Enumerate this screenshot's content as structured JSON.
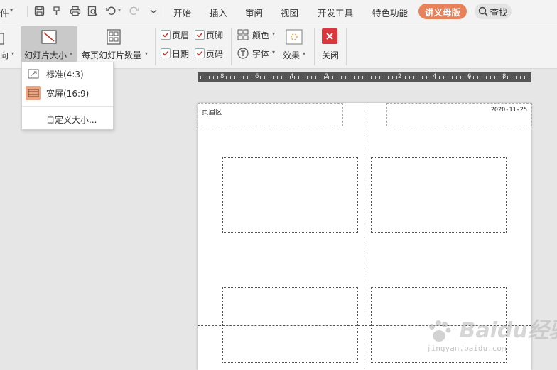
{
  "quick_access": {
    "file_menu_fragment": "件"
  },
  "tabs": [
    {
      "label": "开始"
    },
    {
      "label": "插入"
    },
    {
      "label": "审阅"
    },
    {
      "label": "视图"
    },
    {
      "label": "开发工具"
    },
    {
      "label": "特色功能"
    },
    {
      "label": "讲义母版",
      "active": true
    }
  ],
  "search": {
    "label": "查找"
  },
  "ribbon": {
    "orientation_fragment": "向",
    "slide_size": "幻灯片大小",
    "per_page": "每页幻灯片数量",
    "header_cb": "页眉",
    "footer_cb": "页脚",
    "date_cb": "日期",
    "page_no_cb": "页码",
    "color": "颜色",
    "font": "字体",
    "effects": "效果",
    "close": "关闭"
  },
  "dropdown": {
    "items": [
      {
        "label": "标准(4:3)",
        "icon": "standard-ratio-icon"
      },
      {
        "label": "宽屏(16:9)",
        "icon": "widescreen-ratio-icon",
        "selected": true
      },
      {
        "label": "自定义大小..."
      }
    ]
  },
  "ruler": {
    "labels": [
      "8",
      "6",
      "4",
      "2",
      "2",
      "4",
      "6",
      "8"
    ]
  },
  "handout": {
    "header_text": "页眉区",
    "date_text": "2020-11-25"
  },
  "watermark": {
    "text": "Baidu经验",
    "url": "jingyan.baidu.com"
  },
  "colors": {
    "accent_tab": "#e8825a",
    "close_button": "#d9363e",
    "selected_button": "#c9c9c9"
  }
}
